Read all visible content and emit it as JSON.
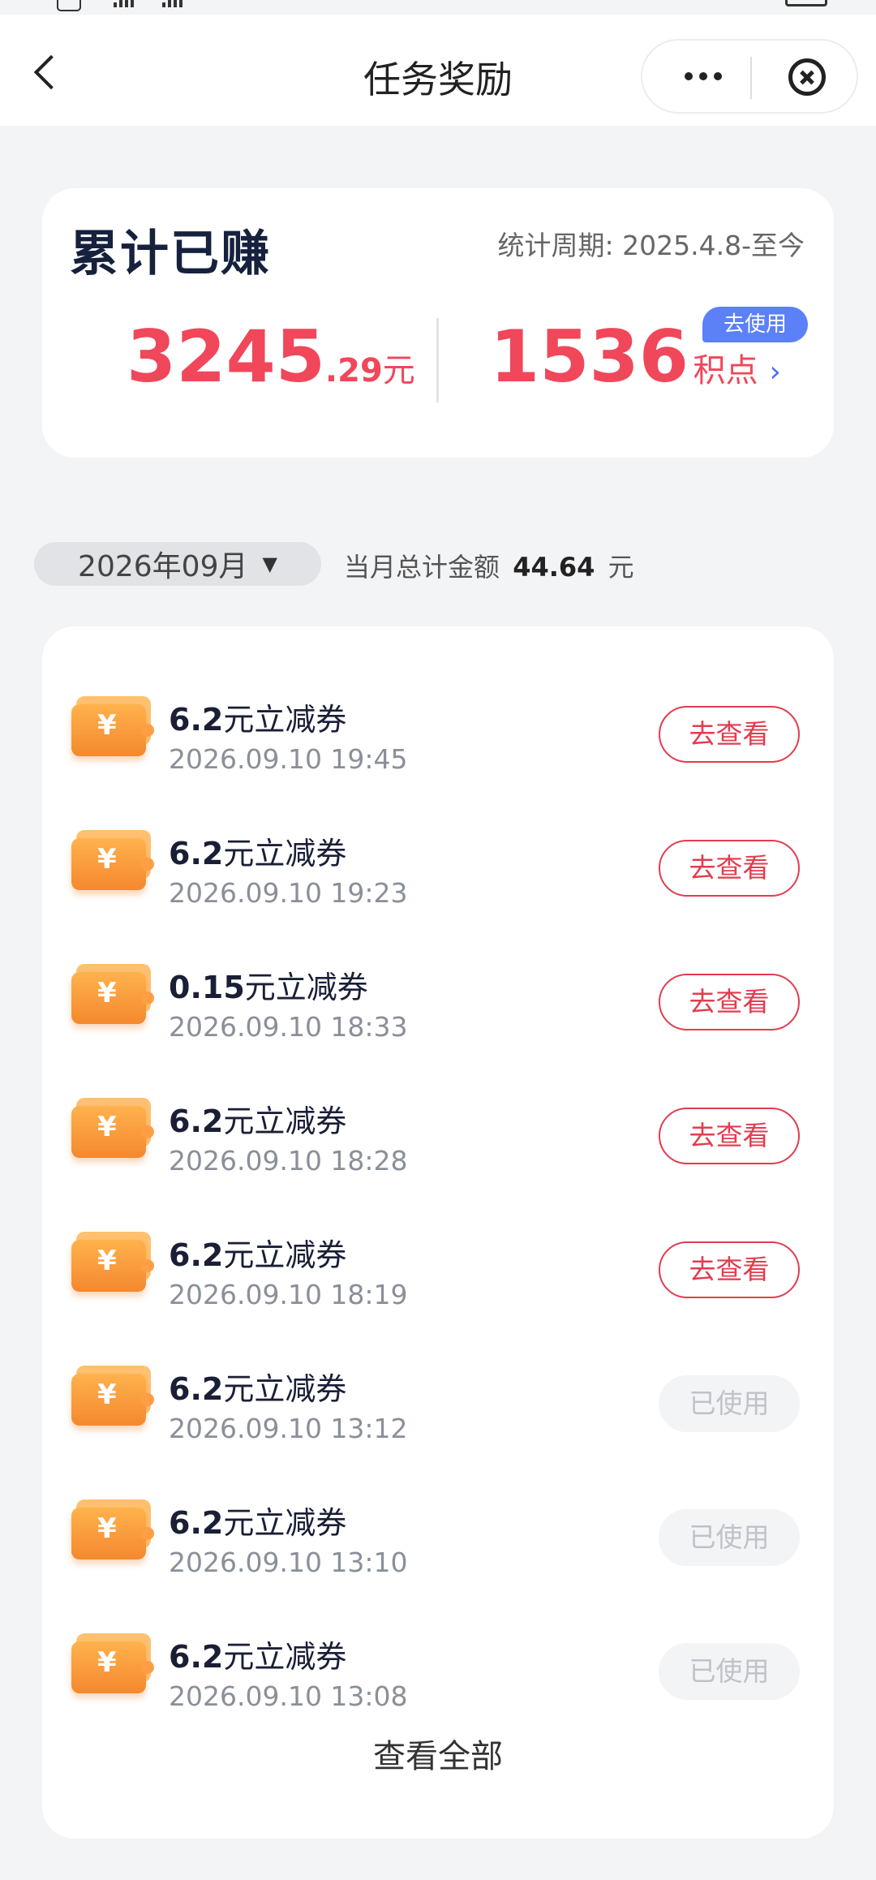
{
  "header": {
    "title": "任务奖励"
  },
  "summary": {
    "title": "累计已赚",
    "period": "统计周期: 2025.4.8-至今",
    "money_int": "3245",
    "money_dec": ".29",
    "money_unit": "元",
    "points": "1536",
    "points_unit": "积点",
    "use_badge": "去使用"
  },
  "filter": {
    "month": "2026年09月",
    "total_label": "当月总计金额",
    "total_value": "44.64",
    "total_unit": "元"
  },
  "records": [
    {
      "amount": "6.2",
      "suffix": "元立减券",
      "time": "2026.09.10 19:45",
      "action": "去查看",
      "status": "view"
    },
    {
      "amount": "6.2",
      "suffix": "元立减券",
      "time": "2026.09.10 19:23",
      "action": "去查看",
      "status": "view"
    },
    {
      "amount": "0.15",
      "suffix": "元立减券",
      "time": "2026.09.10 18:33",
      "action": "去查看",
      "status": "view"
    },
    {
      "amount": "6.2",
      "suffix": "元立减券",
      "time": "2026.09.10 18:28",
      "action": "去查看",
      "status": "view"
    },
    {
      "amount": "6.2",
      "suffix": "元立减券",
      "time": "2026.09.10 18:19",
      "action": "去查看",
      "status": "view"
    },
    {
      "amount": "6.2",
      "suffix": "元立减券",
      "time": "2026.09.10 13:12",
      "action": "已使用",
      "status": "used"
    },
    {
      "amount": "6.2",
      "suffix": "元立减券",
      "time": "2026.09.10 13:10",
      "action": "已使用",
      "status": "used"
    },
    {
      "amount": "6.2",
      "suffix": "元立减券",
      "time": "2026.09.10 13:08",
      "action": "已使用",
      "status": "used"
    }
  ],
  "view_all": "查看全部",
  "colors": {
    "accent_red": "#f0475a",
    "badge_blue": "#5b80f7",
    "ticket_orange": "#f5882e"
  },
  "icons": {
    "back": "back-arrow-icon",
    "more": "more-dots-icon",
    "close": "close-circle-icon",
    "coupon": "coupon-ticket-icon",
    "dropdown": "dropdown-triangle-icon",
    "chevron": "chevron-right-icon"
  }
}
